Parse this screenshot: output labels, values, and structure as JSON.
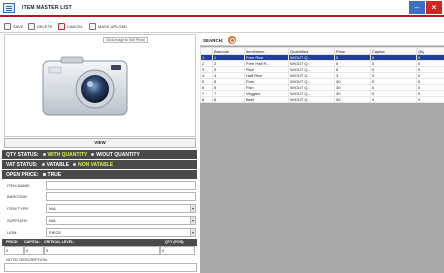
{
  "window": {
    "title": "ITEM MASTER LIST"
  },
  "toolbar": {
    "save": "SAVE",
    "delete": "DELETE",
    "cancel": "CANCEL",
    "mass_upload": "MASS UPLOAD"
  },
  "photo": {
    "hint": "Click image to Edit Photo",
    "view_label": "VIEW"
  },
  "status": {
    "qty_label": "QTY STATUS:",
    "qty_options": [
      "WITH QUANTITY",
      "W/OUT QUANTITY"
    ],
    "vat_label": "VAT STATUS:",
    "vat_options": [
      "VATABLE",
      "NON VATABLE"
    ],
    "open_price_label": "OPEN PRICE:",
    "open_price_option": "TRUE"
  },
  "form": {
    "item_name_label": "ITEM NAME:",
    "item_name_value": "",
    "barcode_label": "BARCODE:",
    "barcode_value": "",
    "item_type_label": "ITEM TYPE:",
    "item_type_value": "N/A",
    "supplier_label": "SUPPLIER:",
    "supplier_value": "N/A",
    "uom_label": "UOM:",
    "uom_value": "PIECE",
    "price_label": "PRICE:",
    "capital_label": "CAPITAL:",
    "critical_label": "CRITICAL LEVEL:",
    "qty_pos_label": "QTY (POS):",
    "price_value": "0",
    "capital_value": "0",
    "critical_value": "0",
    "qty_pos_value": "0",
    "notes_label": "NOTE/ DESCRIPTION:"
  },
  "search": {
    "label": "SEARCH:"
  },
  "table": {
    "headers": [
      "",
      "Barcode",
      "ItemName",
      "Quantified",
      "Price",
      "Capital",
      "Qty"
    ],
    "rows": [
      [
        "1",
        "1",
        "Free Rice",
        "W/OUT Q...",
        "0",
        "0",
        "0"
      ],
      [
        "2",
        "2",
        "Free Half R...",
        "W/OUT Q...",
        "0",
        "0",
        "0"
      ],
      [
        "3",
        "3",
        "Rice",
        "W/OUT Q...",
        "6",
        "0",
        "0"
      ],
      [
        "4",
        "4",
        "Half Rice",
        "W/OUT Q...",
        "3",
        "0",
        "0"
      ],
      [
        "5",
        "5",
        "Pork",
        "W/OUT Q...",
        "30",
        "0",
        "0"
      ],
      [
        "6",
        "6",
        "Fish",
        "W/OUT Q...",
        "30",
        "0",
        "0"
      ],
      [
        "7",
        "7",
        "Veggies",
        "W/OUT Q...",
        "30",
        "0",
        "0"
      ],
      [
        "8",
        "8",
        "Beef",
        "W/OUT Q...",
        "30",
        "0",
        "0"
      ]
    ],
    "selected_index": 0
  },
  "colors": {
    "accent_red": "#b21b1b",
    "selected_row": "#1f3f9b",
    "status_bar": "#4a4a4a",
    "selected_option": "#d9f04b"
  }
}
